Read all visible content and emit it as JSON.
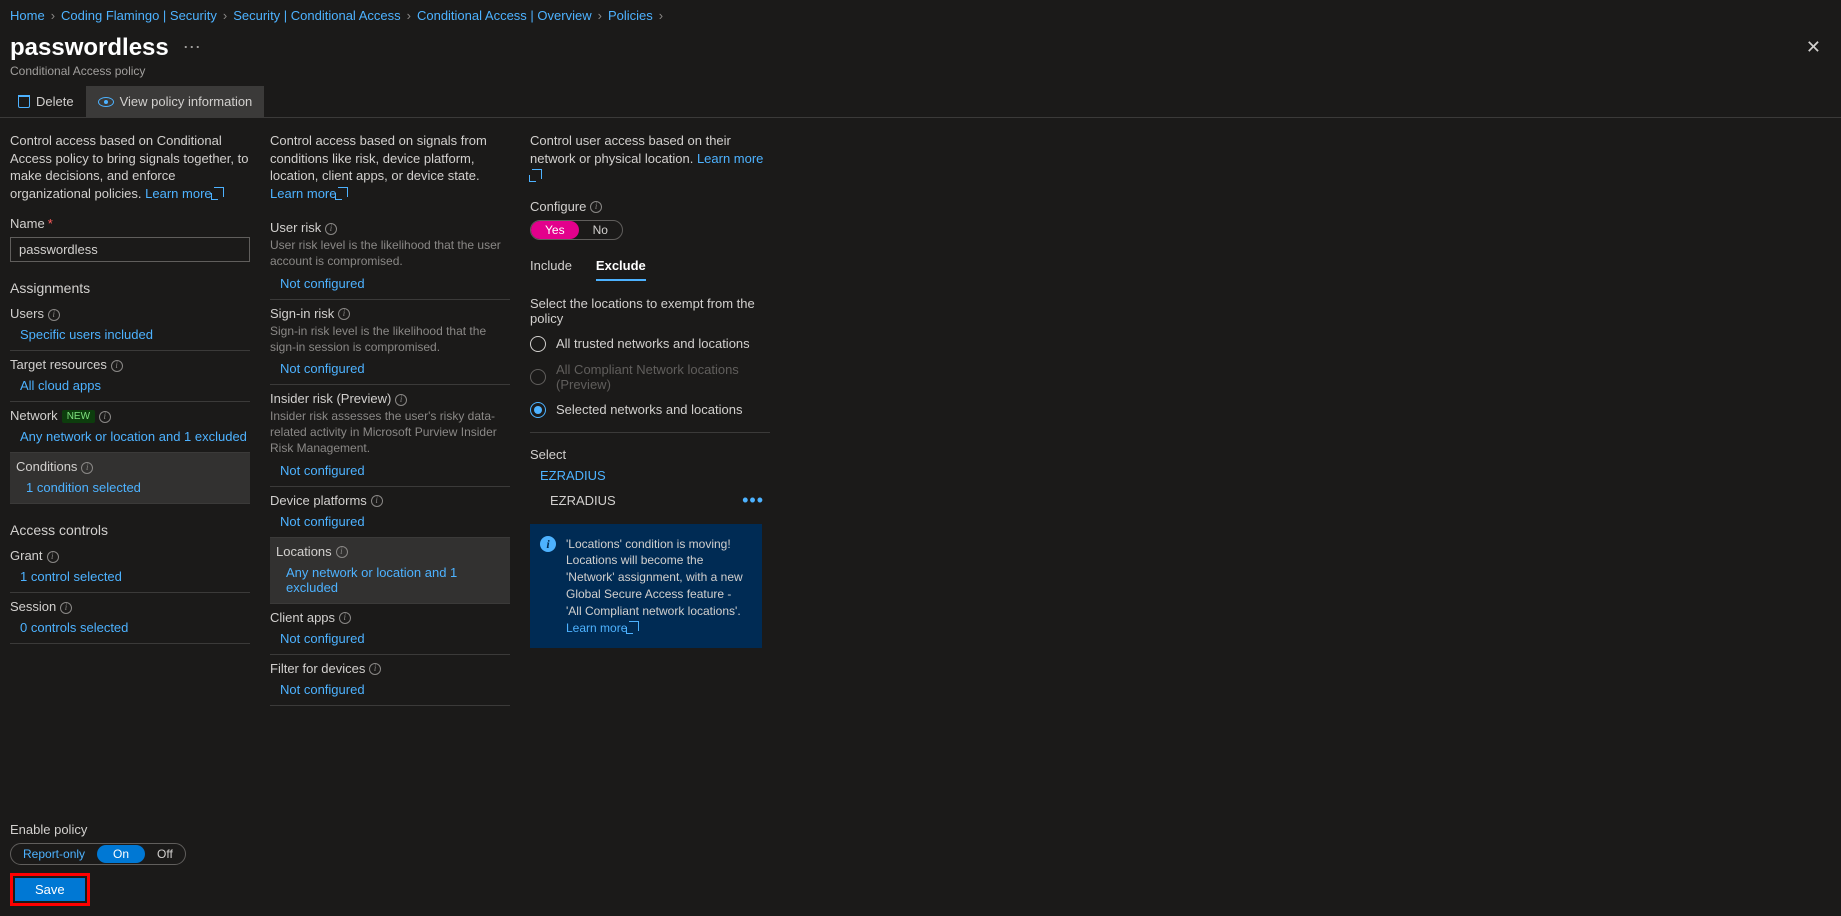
{
  "breadcrumb": [
    "Home",
    "Coding Flamingo | Security",
    "Security | Conditional Access",
    "Conditional Access | Overview",
    "Policies"
  ],
  "page": {
    "title": "passwordless",
    "subtitle": "Conditional Access policy"
  },
  "toolbar": {
    "delete": "Delete",
    "view_info": "View policy information"
  },
  "col1": {
    "desc": "Control access based on Conditional Access policy to bring signals together, to make decisions, and enforce organizational policies.",
    "learn_more": "Learn more",
    "name_label": "Name",
    "name_value": "passwordless",
    "assignments": "Assignments",
    "users_label": "Users",
    "users_link": "Specific users included",
    "target_label": "Target resources",
    "target_link": "All cloud apps",
    "network_label": "Network",
    "new_badge": "NEW",
    "network_link": "Any network or location and 1 excluded",
    "conditions_label": "Conditions",
    "conditions_link": "1 condition selected",
    "access_controls": "Access controls",
    "grant_label": "Grant",
    "grant_link": "1 control selected",
    "session_label": "Session",
    "session_link": "0 controls selected"
  },
  "col2": {
    "desc": "Control access based on signals from conditions like risk, device platform, location, client apps, or device state.",
    "learn_more": "Learn more",
    "user_risk_label": "User risk",
    "user_risk_sub": "User risk level is the likelihood that the user account is compromised.",
    "signin_risk_label": "Sign-in risk",
    "signin_risk_sub": "Sign-in risk level is the likelihood that the sign-in session is compromised.",
    "insider_label": "Insider risk (Preview)",
    "insider_sub": "Insider risk assesses the user's risky data-related activity in Microsoft Purview Insider Risk Management.",
    "device_platforms": "Device platforms",
    "locations_label": "Locations",
    "locations_link": "Any network or location and 1 excluded",
    "client_apps": "Client apps",
    "filter_devices": "Filter for devices",
    "not_configured": "Not configured"
  },
  "col3": {
    "desc": "Control user access based on their network or physical location.",
    "learn_more": "Learn more",
    "configure_label": "Configure",
    "yes": "Yes",
    "no": "No",
    "tab_include": "Include",
    "tab_exclude": "Exclude",
    "exempt_heading": "Select the locations to exempt from the policy",
    "radio1": "All trusted networks and locations",
    "radio2": "All Compliant Network locations (Preview)",
    "radio3": "Selected networks and locations",
    "select_label": "Select",
    "select_link": "EZRADIUS",
    "selected_item": "EZRADIUS",
    "banner": "'Locations' condition is moving! Locations will become the 'Network' assignment, with a new Global Secure Access feature - 'All Compliant network locations'.",
    "banner_learn": "Learn more"
  },
  "footer": {
    "enable_label": "Enable policy",
    "report_only": "Report-only",
    "on": "On",
    "off": "Off",
    "save": "Save"
  }
}
